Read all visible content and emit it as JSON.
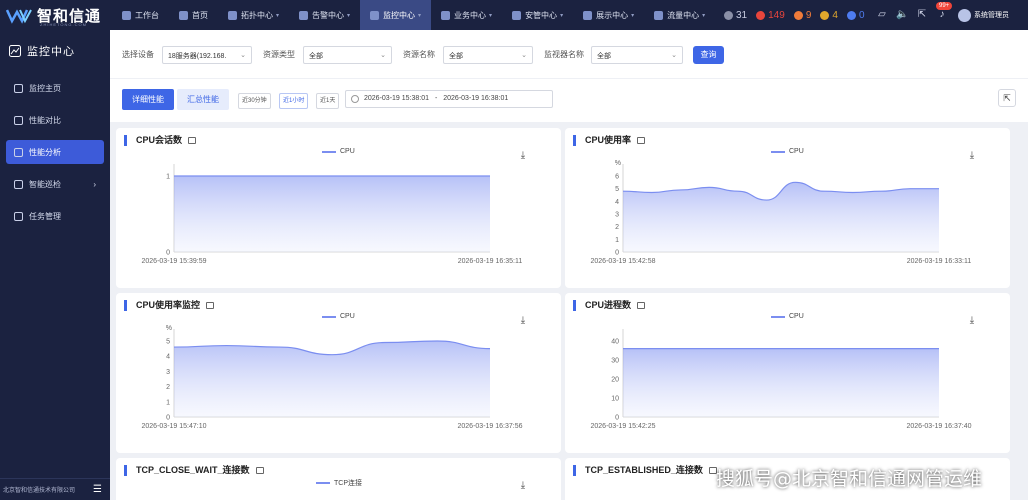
{
  "topbar": {
    "brand": "智和信通",
    "brand_sub": "ZHIHETONG.COM",
    "nav": [
      {
        "label": "工作台",
        "icon": "desk-icon",
        "active": false,
        "chevron": false
      },
      {
        "label": "首页",
        "icon": "home-icon",
        "active": false,
        "chevron": false
      },
      {
        "label": "拓扑中心",
        "icon": "topology-icon",
        "active": false,
        "chevron": true
      },
      {
        "label": "告警中心",
        "icon": "alarm-icon",
        "active": false,
        "chevron": true
      },
      {
        "label": "监控中心",
        "icon": "monitor-icon",
        "active": true,
        "chevron": true
      },
      {
        "label": "业务中心",
        "icon": "business-icon",
        "active": false,
        "chevron": true
      },
      {
        "label": "安管中心",
        "icon": "security-icon",
        "active": false,
        "chevron": true
      },
      {
        "label": "展示中心",
        "icon": "display-icon",
        "active": false,
        "chevron": true
      },
      {
        "label": "流量中心",
        "icon": "traffic-icon",
        "active": false,
        "chevron": true
      }
    ],
    "alarms": [
      {
        "count": "31",
        "color": "#8a8fa6"
      },
      {
        "count": "149",
        "color": "#e8453c"
      },
      {
        "count": "9",
        "color": "#f07b3a"
      },
      {
        "count": "4",
        "color": "#e0a72c"
      },
      {
        "count": "0",
        "color": "#4e7cf0"
      }
    ],
    "badge": "99+",
    "user": "系统管理员"
  },
  "sidebar": {
    "title": "监控中心",
    "items": [
      {
        "label": "监控主页",
        "name": "sidebar-item-monitor-home",
        "icon": "home-icon",
        "active": false,
        "arrow": false
      },
      {
        "label": "性能对比",
        "name": "sidebar-item-compare",
        "icon": "compare-icon",
        "active": false,
        "arrow": false
      },
      {
        "label": "性能分析",
        "name": "sidebar-item-analysis",
        "icon": "analysis-icon",
        "active": true,
        "arrow": false
      },
      {
        "label": "智能巡检",
        "name": "sidebar-item-inspection",
        "icon": "inspect-icon",
        "active": false,
        "arrow": true
      },
      {
        "label": "任务管理",
        "name": "sidebar-item-tasks",
        "icon": "task-icon",
        "active": false,
        "arrow": false
      }
    ],
    "footer": "北京智和信通技术有限公司"
  },
  "filters": {
    "device_label": "选择设备",
    "device_value": "18服务器(192.168.",
    "type_label": "资源类型",
    "type_value": "全部",
    "res_label": "资源名称",
    "res_value": "全部",
    "mon_label": "监视器名称",
    "mon_value": "全部",
    "query": "查询"
  },
  "panel": {
    "tab_detail": "详细性能",
    "tab_summary": "汇总性能",
    "ranges": [
      "近30分钟",
      "近1小时",
      "近1天"
    ],
    "date_start": "2026-03-19 15:38:01",
    "date_sep": "-",
    "date_end": "2026-03-19 16:38:01"
  },
  "cards": {
    "c1": {
      "title": "CPU会话数",
      "legend": "CPU"
    },
    "c2": {
      "title": "CPU使用率",
      "legend": "CPU"
    },
    "c3": {
      "title": "CPU使用率监控",
      "legend": "CPU"
    },
    "c4": {
      "title": "CPU进程数",
      "legend": "CPU"
    },
    "c5": {
      "title": "TCP_CLOSE_WAIT_连接数",
      "legend": "TCP连接"
    },
    "c6": {
      "title": "TCP_ESTABLISHED_连接数"
    }
  },
  "chart_data": [
    {
      "type": "area",
      "title": "CPU会话数",
      "series": [
        {
          "name": "CPU",
          "values": [
            1,
            1,
            1,
            1,
            1,
            1,
            1
          ]
        }
      ],
      "x_start": "2026-03-19 15:39:59",
      "x_end": "2026-03-19 16:35:11",
      "yticks": [
        "0",
        "1"
      ],
      "ylim": [
        0,
        1
      ],
      "unit": ""
    },
    {
      "type": "area",
      "title": "CPU使用率",
      "series": [
        {
          "name": "CPU",
          "values": [
            4.8,
            4.7,
            4.9,
            5.1,
            4.8,
            4.1,
            5.5,
            4.8,
            4.7,
            4.8,
            5.0,
            5.0
          ]
        }
      ],
      "x_start": "2026-03-19 15:42:58",
      "x_end": "2026-03-19 16:33:11",
      "yticks": [
        "0",
        "1",
        "2",
        "3",
        "4",
        "5",
        "6"
      ],
      "ylim": [
        0,
        6
      ],
      "unit": "%"
    },
    {
      "type": "area",
      "title": "CPU使用率监控",
      "series": [
        {
          "name": "CPU",
          "values": [
            4.6,
            4.7,
            4.6,
            4.1,
            4.9,
            5.0,
            4.5
          ]
        }
      ],
      "x_start": "2026-03-19 15:47:10",
      "x_end": "2026-03-19 16:37:56",
      "yticks": [
        "0",
        "1",
        "2",
        "3",
        "4",
        "5"
      ],
      "ylim": [
        0,
        5
      ],
      "unit": "%"
    },
    {
      "type": "area",
      "title": "CPU进程数",
      "series": [
        {
          "name": "CPU",
          "values": [
            36,
            36,
            36,
            36,
            36,
            36,
            36
          ]
        }
      ],
      "x_start": "2026-03-19 15:42:25",
      "x_end": "2026-03-19 16:37:40",
      "yticks": [
        "0",
        "10",
        "20",
        "30",
        "40"
      ],
      "ylim": [
        0,
        40
      ],
      "unit": ""
    }
  ],
  "watermark": "搜狐号@北京智和信通网管运维",
  "colors": {
    "accent": "#3e66e6",
    "nav_bg": "#1b2240",
    "line": "#7b8ef0"
  }
}
